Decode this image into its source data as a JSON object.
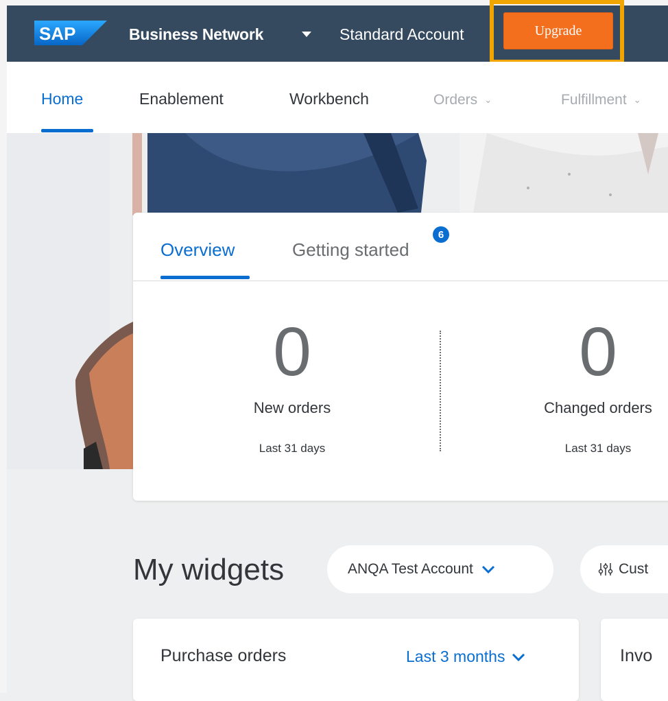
{
  "shellbar": {
    "logo_text": "SAP",
    "title": "Business Network",
    "account_type": "Standard Account",
    "upgrade_label": "Upgrade"
  },
  "nav": {
    "items": [
      {
        "label": "Home"
      },
      {
        "label": "Enablement"
      },
      {
        "label": "Workbench"
      },
      {
        "label": "Orders"
      },
      {
        "label": "Fulfillment"
      }
    ]
  },
  "overview": {
    "tabs": [
      {
        "label": "Overview"
      },
      {
        "label": "Getting started",
        "badge": "6"
      }
    ],
    "kpis": [
      {
        "value": "0",
        "label": "New orders",
        "period": "Last 31 days"
      },
      {
        "value": "0",
        "label": "Changed orders",
        "period": "Last 31 days"
      }
    ]
  },
  "widgets": {
    "title": "My widgets",
    "account_filter": "ANQA Test Account",
    "customize_label": "Cust",
    "cards": [
      {
        "title": "Purchase orders",
        "filter": "Last 3 months"
      },
      {
        "title": "Invo"
      }
    ]
  },
  "colors": {
    "shellbar": "#354a5f",
    "accent": "#0a6ed1",
    "upgrade": "#f46f1d",
    "highlight": "#f0a500"
  }
}
